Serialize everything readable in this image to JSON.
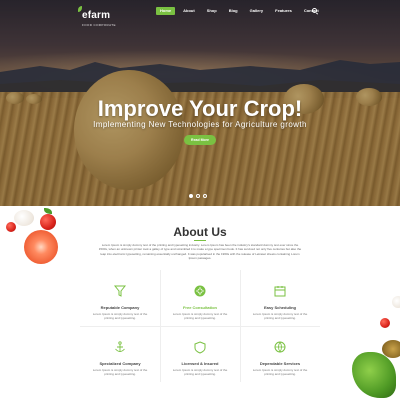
{
  "brand": {
    "name": "efarm",
    "tagline": "FOOD CORPORATE"
  },
  "nav": {
    "items": [
      {
        "label": "Home",
        "active": true
      },
      {
        "label": "About",
        "active": false
      },
      {
        "label": "Shop",
        "active": false
      },
      {
        "label": "Blog",
        "active": false
      },
      {
        "label": "Gallery",
        "active": false
      },
      {
        "label": "Features",
        "active": false
      },
      {
        "label": "Contact",
        "active": false
      }
    ],
    "search_icon": "search-icon"
  },
  "hero": {
    "title": "Improve Your Crop!",
    "subtitle": "Implementing New Technologies for Agriculture growth",
    "button": "Read More",
    "slides_total": 3,
    "active_slide": 1
  },
  "about": {
    "title": "About Us",
    "text": "Lorem Ipsum is simply dummy text of the printing and typesetting industry. Lorem Ipsum has been the industry's standard dummy text ever since the 1500s, when an unknown printer took a galley of type and scrambled it to make a type specimen book. It has survived not only five centuries but also the leap into electronic typesetting, remaining essentially unchanged. It was popularised in the 1960s with the release of Letraset sheets containing Lorem Ipsum passages."
  },
  "features": [
    {
      "title": "Reputable Company",
      "text": "Lorem Ipsum is simply dummy text of the printing and typesetting.",
      "icon": "funnel-icon",
      "highlight": false
    },
    {
      "title": "Free Consultation",
      "text": "Lorem Ipsum is simply dummy text of the printing and typesetting.",
      "icon": "sun-icon",
      "highlight": true
    },
    {
      "title": "Easy Scheduling",
      "text": "Lorem Ipsum is simply dummy text of the printing and typesetting.",
      "icon": "calendar-icon",
      "highlight": false
    },
    {
      "title": "Specialized Company",
      "text": "Lorem Ipsum is simply dummy text of the printing and typesetting.",
      "icon": "anchor-icon",
      "highlight": false
    },
    {
      "title": "Licensed & Insured",
      "text": "Lorem Ipsum is simply dummy text of the printing and typesetting.",
      "icon": "shield-icon",
      "highlight": false
    },
    {
      "title": "Dependable Services",
      "text": "Lorem Ipsum is simply dummy text of the printing and typesetting.",
      "icon": "globe-icon",
      "highlight": false
    }
  ],
  "colors": {
    "accent": "#7ac142",
    "heading": "#333333",
    "body_text": "#777777"
  }
}
